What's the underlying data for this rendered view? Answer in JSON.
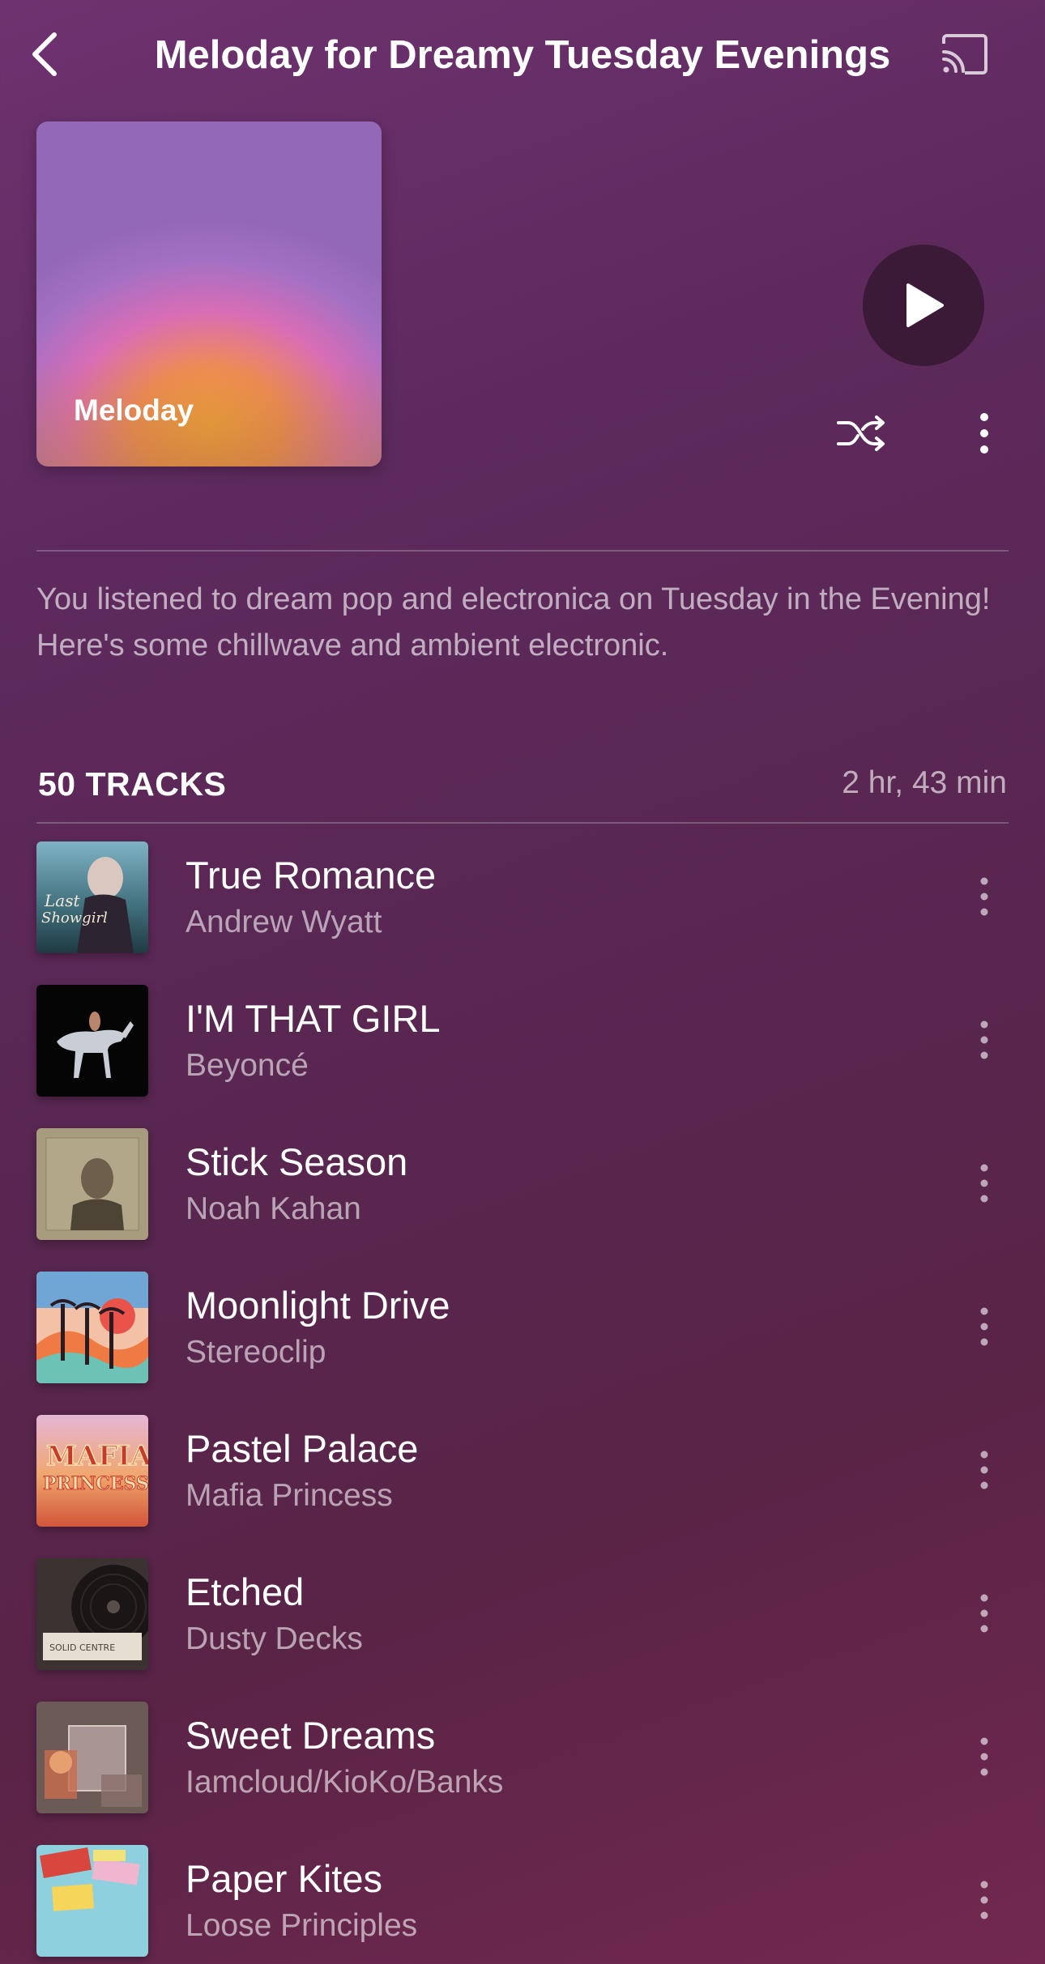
{
  "header": {
    "title": "Meloday for Dreamy Tuesday Evenings",
    "back_icon": "chevron-left-icon",
    "cast_icon": "cast-icon"
  },
  "playlist": {
    "cover_label": "Meloday",
    "description": "You listened to dream pop and electronica on Tuesday in the Evening! Here's some chillwave and ambient electronic.",
    "track_count_label": "50 TRACKS",
    "duration": "2 hr, 43 min"
  },
  "controls": {
    "play_icon": "play-icon",
    "shuffle_icon": "shuffle-icon",
    "more_icon": "more-vertical-icon"
  },
  "tracks": [
    {
      "title": "True Romance",
      "artist": "Andrew Wyatt"
    },
    {
      "title": "I'M THAT GIRL",
      "artist": "Beyoncé"
    },
    {
      "title": "Stick Season",
      "artist": "Noah Kahan"
    },
    {
      "title": "Moonlight Drive",
      "artist": "Stereoclip"
    },
    {
      "title": "Pastel Palace",
      "artist": "Mafia Princess"
    },
    {
      "title": "Etched",
      "artist": "Dusty Decks"
    },
    {
      "title": "Sweet Dreams",
      "artist": "Iamcloud/KioKo/Banks"
    },
    {
      "title": "Paper Kites",
      "artist": "Loose Principles"
    }
  ],
  "colors": {
    "background_top": "#6e3270",
    "background_bottom": "#72284f",
    "play_button_bg": "#3a1a36"
  }
}
